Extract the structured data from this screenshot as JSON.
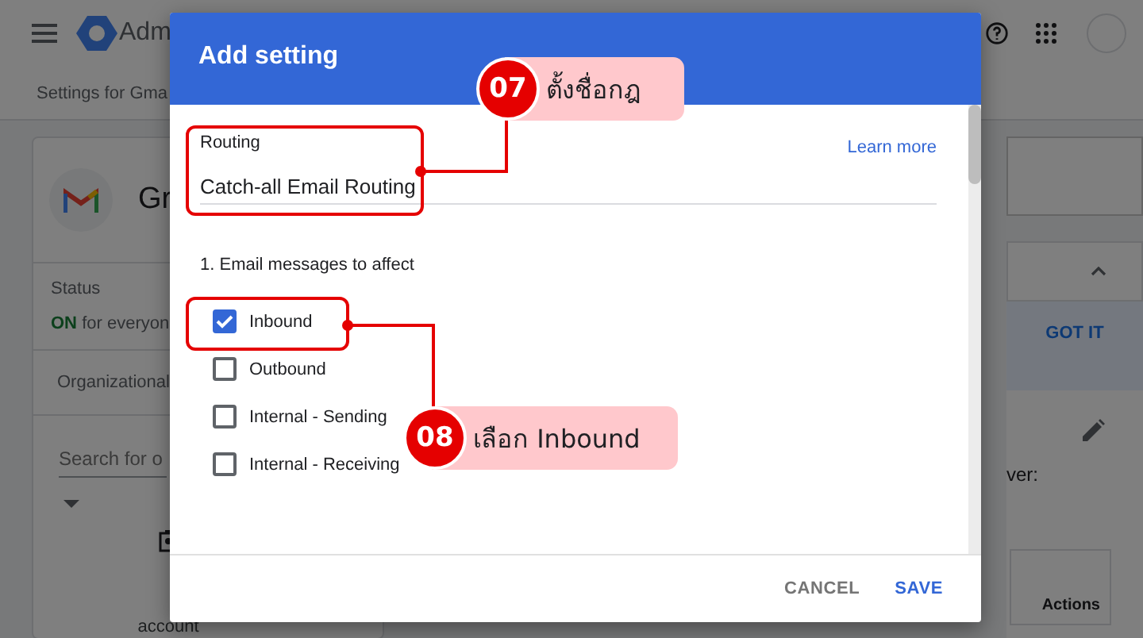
{
  "app_bar": {
    "product": "Adm"
  },
  "breadcrumb": "Settings for Gma",
  "left_panel": {
    "title": "Gr",
    "status_label": "Status",
    "status_value": "ON",
    "status_scope": "for everyon",
    "org_label": "Organizational",
    "search_placeholder": "Search for o",
    "account_label": "account"
  },
  "right_panel": {
    "banner_button": "GOT IT",
    "text_fragment": "ver:",
    "table_header": "Actions"
  },
  "dialog": {
    "title": "Add setting",
    "field": {
      "label": "Routing",
      "value": "Catch-all Email Routing"
    },
    "learn_more": "Learn more",
    "section": "1. Email messages to affect",
    "options": [
      {
        "label": "Inbound",
        "checked": true
      },
      {
        "label": "Outbound",
        "checked": false
      },
      {
        "label": "Internal - Sending",
        "checked": false
      },
      {
        "label": "Internal - Receiving",
        "checked": false
      }
    ],
    "buttons": [
      {
        "label": "CANCEL",
        "kind": "secondary"
      },
      {
        "label": "SAVE",
        "kind": "primary"
      }
    ]
  },
  "annotations": [
    {
      "number": "07",
      "text": "ตั้งชื่อกฎ"
    },
    {
      "number": "08",
      "text": "เลือก Inbound"
    }
  ]
}
